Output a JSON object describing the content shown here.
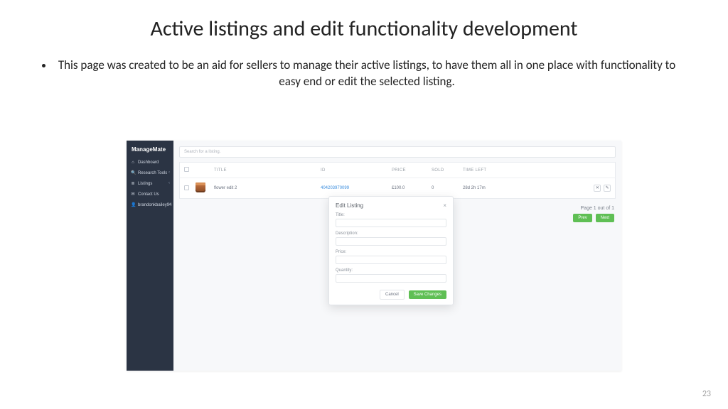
{
  "slide": {
    "title": "Active listings and edit functionality development",
    "bullet": "This page was created to be an aid for sellers to manage their active listings, to have them all in one place with functionality to easy end or edit the selected listing.",
    "page_number": "23"
  },
  "app": {
    "brand": "ManageMate",
    "nav": [
      {
        "icon": "⌂",
        "label": "Dashboard",
        "chev": ""
      },
      {
        "icon": "🔍",
        "label": "Research Tools",
        "chev": "‹"
      },
      {
        "icon": "≣",
        "label": "Listings",
        "chev": "‹"
      },
      {
        "icon": "✉",
        "label": "Contact Us",
        "chev": ""
      },
      {
        "icon": "👤",
        "label": "brandonkbailey94",
        "chev": "‹"
      }
    ],
    "search_placeholder": "Search for a listing.",
    "columns": {
      "title": "TITLE",
      "id": "ID",
      "price": "PRICE",
      "sold": "SOLD",
      "time": "TIME LEFT"
    },
    "row": {
      "title": "flower edit 2",
      "id": "404203970099",
      "price": "£100.0",
      "sold": "0",
      "time": "28d 2h 17m",
      "act1": "✕",
      "act2": "✎"
    },
    "pagination": {
      "text": "Page 1 out of 1",
      "prev": "Prev",
      "next": "Next"
    },
    "modal": {
      "title": "Edit Listing",
      "labels": {
        "title": "Title:",
        "desc": "Description:",
        "price": "Price:",
        "qty": "Quantity:"
      },
      "cancel": "Cancel",
      "save": "Save Changes"
    }
  }
}
